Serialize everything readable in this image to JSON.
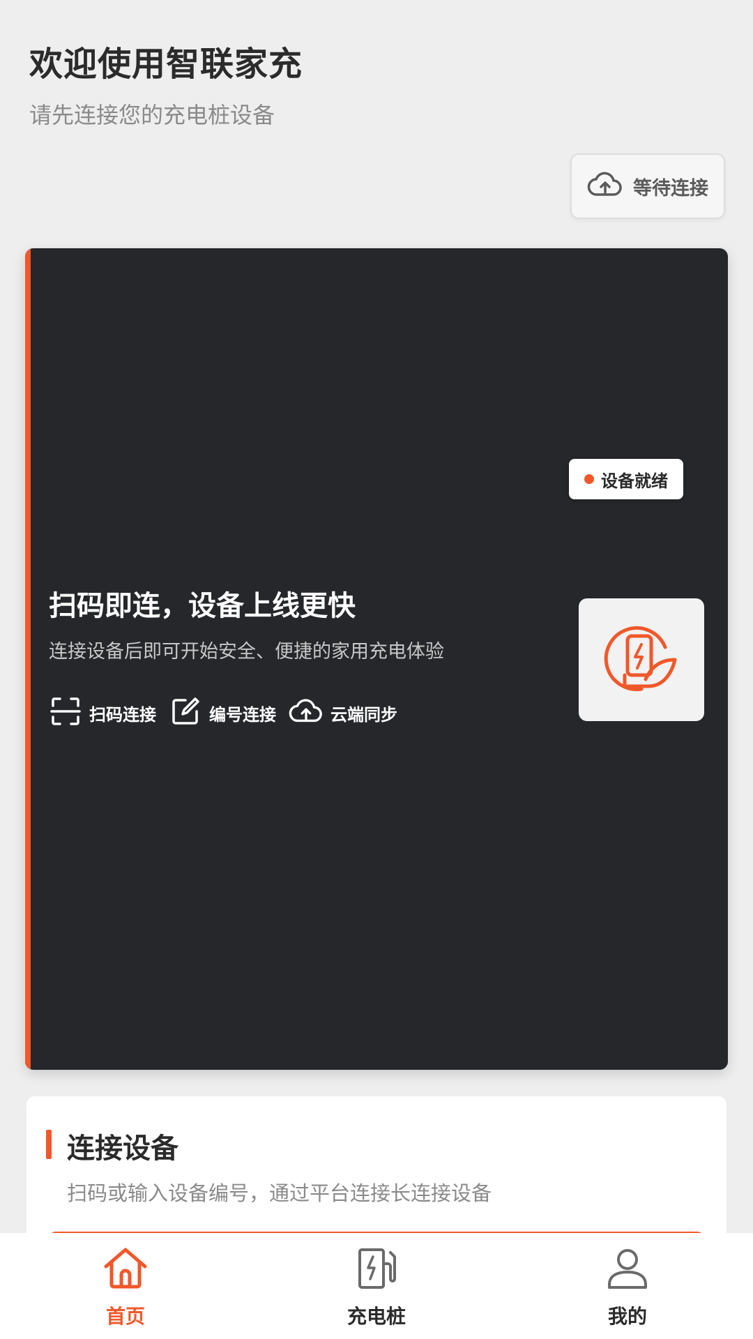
{
  "header": {
    "title": "欢迎使用智联家充",
    "subtitle": "请先连接您的充电桩设备",
    "status_chip": {
      "icon": "cloud-upload-icon",
      "label": "等待连接"
    }
  },
  "hero": {
    "title": "扫码即连，设备上线更快",
    "description": "连接设备后即可开始安全、便捷的家用充电体验",
    "features": [
      {
        "icon": "scan-icon",
        "label": "扫码连接"
      },
      {
        "icon": "edit-icon",
        "label": "编号连接"
      },
      {
        "icon": "cloud-upload-icon",
        "label": "云端同步"
      }
    ],
    "device_tile": {
      "icon": "charger-leaf-icon"
    },
    "badge": {
      "label": "设备就绪"
    }
  },
  "connect_card": {
    "title": "连接设备",
    "description": "扫码或输入设备编号，通过平台连接长连接设备"
  },
  "nav": {
    "items": [
      {
        "icon": "home-icon",
        "label": "首页",
        "active": true
      },
      {
        "icon": "charging-pile-icon",
        "label": "充电桩",
        "active": false
      },
      {
        "icon": "user-icon",
        "label": "我的",
        "active": false
      }
    ]
  },
  "colors": {
    "accent": "#f0582a",
    "hero_bg": "#25272b",
    "page_bg": "#eeeeee"
  }
}
